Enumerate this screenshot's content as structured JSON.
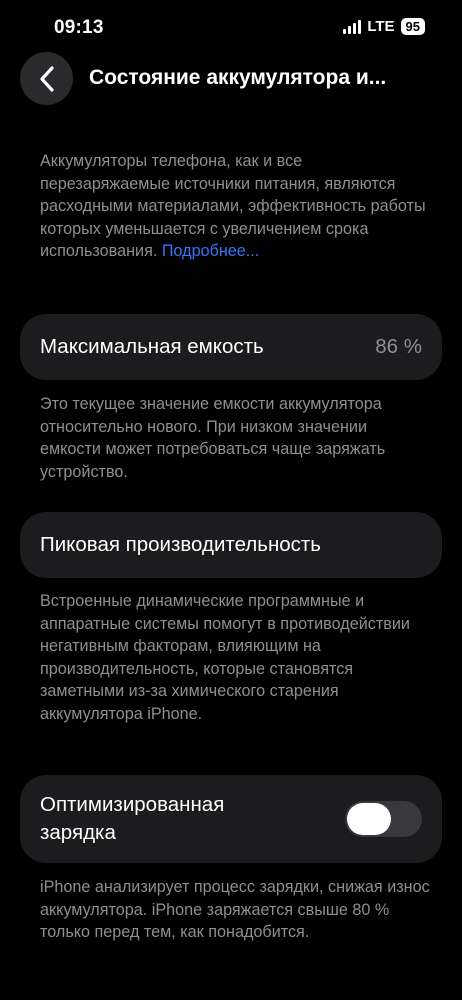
{
  "status_bar": {
    "time": "09:13",
    "network": "LTE",
    "battery": "95"
  },
  "nav": {
    "title": "Состояние аккумулятора и..."
  },
  "intro": {
    "text": "Аккумуляторы телефона, как и все перезаряжаемые источники питания, являются расходными материалами, эффективность работы которых уменьшается с увеличением срока использования.",
    "link": "Подробнее..."
  },
  "max_capacity": {
    "label": "Максимальная емкость",
    "value": "86 %",
    "description": "Это текущее значение емкости аккумулятора относительно нового. При низком значении емкости может потребоваться чаще заряжать устройство."
  },
  "peak_performance": {
    "label": "Пиковая производительность",
    "description": "Встроенные динамические программные и аппаратные системы помогут в противодействии негативным факторам, влияющим на производительность, которые становятся заметными из-за химического старения аккумулятора iPhone."
  },
  "optimized_charging": {
    "label": "Оптимизированная зарядка",
    "enabled": false,
    "description": "iPhone анализирует процесс зарядки, снижая износ аккумулятора. iPhone заряжается свыше 80 % только перед тем, как понадобится."
  },
  "colors": {
    "background": "#000000",
    "card": "#1C1C1E",
    "secondary_text": "#8E8E93",
    "link": "#3478F6",
    "toggle_off": "#39393D"
  }
}
